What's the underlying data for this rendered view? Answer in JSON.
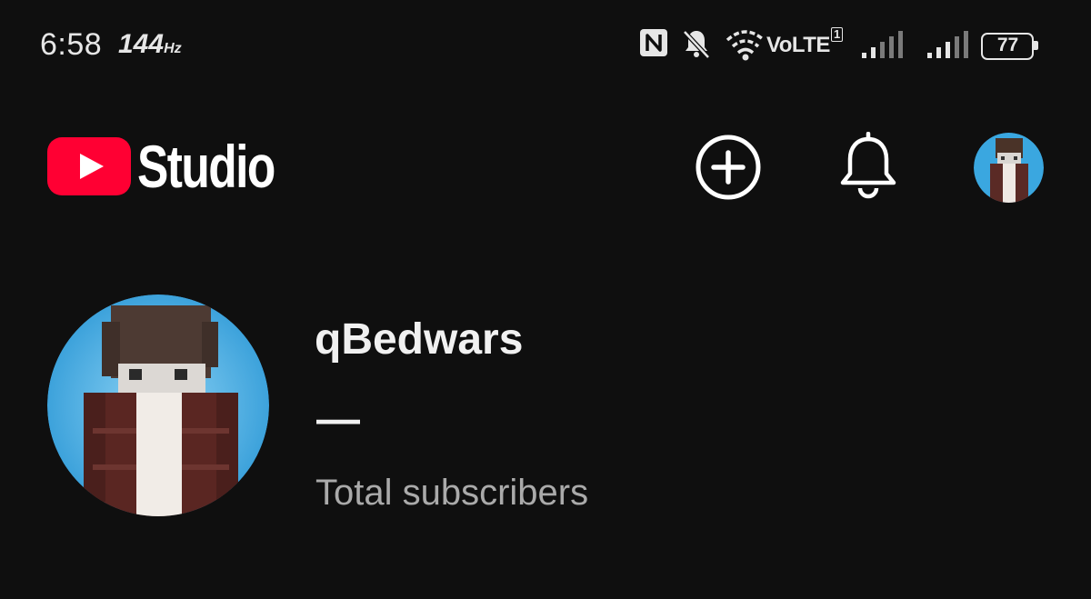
{
  "status_bar": {
    "time": "6:58",
    "refresh_rate": "144",
    "refresh_unit": "Hz",
    "network_label": "VoLTE",
    "network_sup": "1",
    "battery_level": "77",
    "icons": [
      "nfc-icon",
      "bell-off-icon",
      "wifi-icon",
      "signal-icon",
      "signal-icon",
      "battery-icon"
    ]
  },
  "header": {
    "brand": "Studio",
    "logo_icon": "youtube-play-icon",
    "create_icon": "plus-circle-icon",
    "notifications_icon": "bell-icon",
    "brand_color": "#ff0000"
  },
  "channel": {
    "name": "qBedwars",
    "subscriber_count": "—",
    "subscriber_label": "Total subscribers"
  },
  "colors": {
    "background": "#0f0f0f",
    "text_primary": "#f1f1f1",
    "text_secondary": "#aaaaaa",
    "avatar_bg": "#3aa7e0"
  }
}
